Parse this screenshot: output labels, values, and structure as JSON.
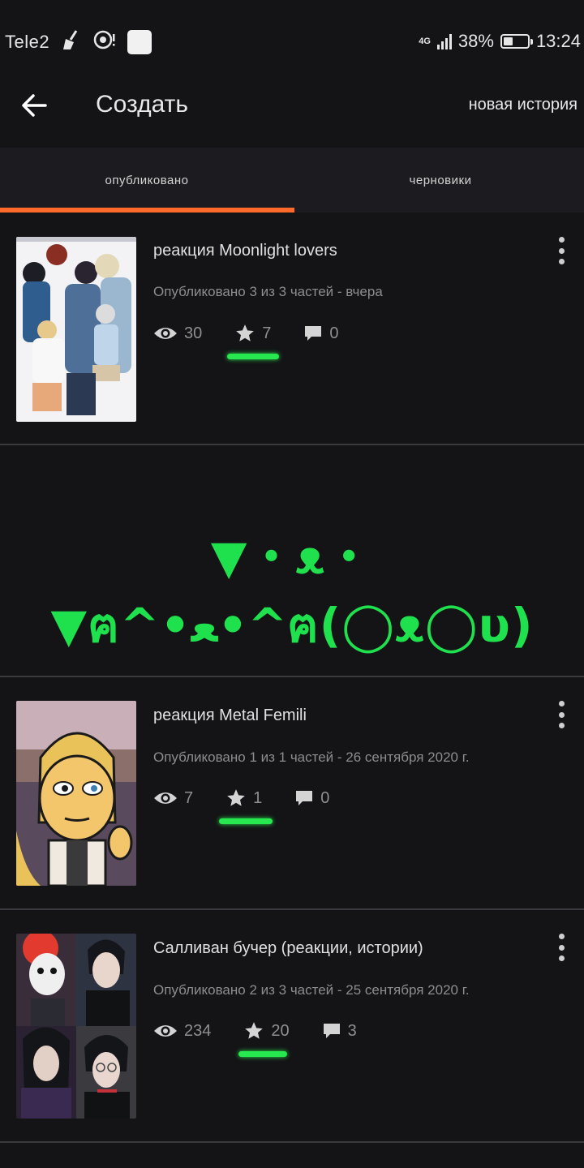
{
  "status_bar": {
    "carrier": "Tele2",
    "network": "4G",
    "battery": "38%",
    "battery_level": 0.38,
    "time": "13:24"
  },
  "header": {
    "title": "Создать",
    "new_story": "новая история"
  },
  "tabs": {
    "published": "опубликовано",
    "drafts": "черновики",
    "active": "published"
  },
  "emoticon": "▼・ᴥ・▼ฅ^•ﻌ•^ฅ(◯ᴥ◯υ)",
  "accent_color": "#ff6a2b",
  "highlight_color": "#27e84f",
  "stories": [
    {
      "title": "реакция Moonlight lovers",
      "meta": "Опубликовано 3 из 3 частей - вчера",
      "views": "30",
      "votes": "7",
      "comments": "0"
    },
    {
      "title": "реакция Metal Femili",
      "meta": "Опубликовано 1 из 1 частей - 26 сентября 2020 г.",
      "views": "7",
      "votes": "1",
      "comments": "0"
    },
    {
      "title": "Салливан бучер (реакции, истории)",
      "meta": "Опубликовано 2 из 3 частей - 25 сентября 2020 г.",
      "views": "234",
      "votes": "20",
      "comments": "3"
    }
  ]
}
